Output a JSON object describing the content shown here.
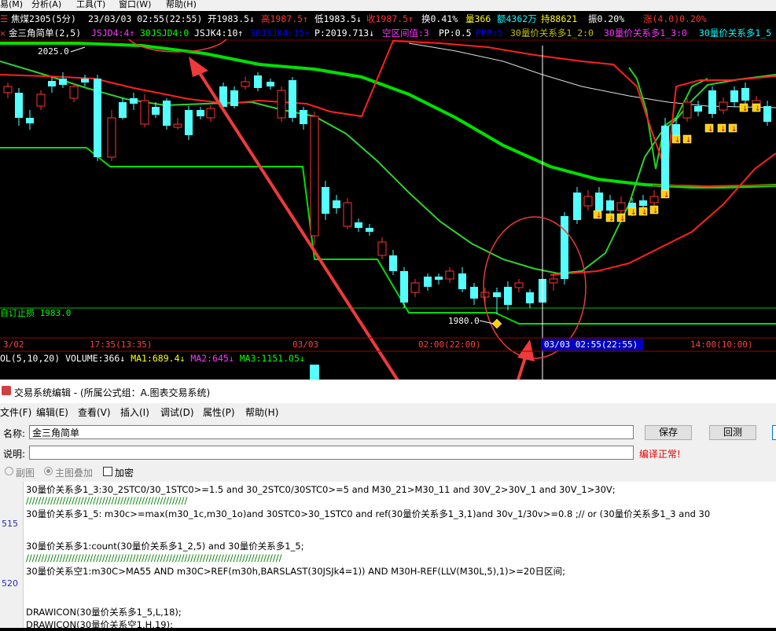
{
  "menubar": {
    "items": [
      "易(M)",
      "分析(A)",
      "工具(T)",
      "窗口(W)",
      "帮助(H)"
    ]
  },
  "infobar": {
    "symbol": "焦煤2305(5分)",
    "datetime": "23/03/03 02:55(22:55)",
    "open": "开1983.5↓",
    "high": "高1987.5↑",
    "low": "低1983.5↓",
    "close": "收1987.5↑",
    "turnover": "换0.41%",
    "volume": "量366",
    "amount": "额4362万",
    "hold": "持88621",
    "amplitude": "振0.20%",
    "change": "涨(4.0)0.20%"
  },
  "indicator_bar": {
    "name": "金三角简单(2,5)",
    "items": [
      {
        "text": "JSJD4:4↑",
        "color": "#ff33ff"
      },
      {
        "text": "30JSJD4:0",
        "color": "#00ff00"
      },
      {
        "text": "JSJK4:10↑",
        "color": "#ffffff"
      },
      {
        "text": "30JSJK4:15↑",
        "color": "#0000ff"
      },
      {
        "text": "P:2019.713↓",
        "color": "#ffffff"
      },
      {
        "text": "空区间值:3",
        "color": "#ff33ff"
      },
      {
        "text": "PP:0.5",
        "color": "#ffffff"
      },
      {
        "text": "PPP:5",
        "color": "#0000ff"
      },
      {
        "text": "30量价关系多1_2:0",
        "color": "#c0c000"
      },
      {
        "text": "30量价关系多1_3:0",
        "color": "#ff33ff"
      },
      {
        "text": "30量价关系多1_5",
        "color": "#00ffff"
      }
    ]
  },
  "chart": {
    "label_high": "2025.0",
    "label_low": "1980.0",
    "stop_label": "自订止损 1983.0",
    "time_axis": [
      "3/02",
      "17:35(13:35)",
      "03/03",
      "02:00(22:00)",
      "03/03 02:55(22:55)",
      "14:00(10:00)"
    ],
    "colors": {
      "up": "#ff3232",
      "down": "#54ffff",
      "green": "#00ff00",
      "red": "#ff2020",
      "white": "#ffffff",
      "arrow": "#ee3a3a"
    }
  },
  "volume_bar": {
    "label": "OL(5,10,20) VOLUME:366↓",
    "ma1": "MA1:689.4↓",
    "ma2": "MA2:645↓",
    "ma3": "MA3:1151.05↓"
  },
  "editor": {
    "title": "交易系统编辑 - (所属公式组：A.图表交易系统)",
    "menu": [
      "文件(F)",
      "编辑(E)",
      "查看(V)",
      "插入(I)",
      "调试(D)",
      "属性(P)",
      "帮助(H)"
    ],
    "name_label": "名称:",
    "name_value": "金三角简单",
    "desc_label": "说明:",
    "desc_value": "",
    "save_button": "保存",
    "revert_button": "回测",
    "status": "编译正常!",
    "radio_sub": "副图",
    "radio_main": "主图叠加",
    "checkbox_encrypt": "加密",
    "line_numbers": [
      "515",
      "520"
    ],
    "code_lines": [
      "30量价关系多1_3:30_2STC0/30_1STC0>=1.5 and 30_2STC0/30STC0>=5  and M30_21>M30_11 and 30V_2>30V_1 and 30V_1>30V;",
      "/////////////////////////////////////////////////////",
      "30量价关系多1_5: m30c>=max(m30_1c,m30_1o)and  30STC0>30_1STC0 and ref(30量价关系多1_3,1)and 30v_1/30v>=0.8 ;// or (30量价关系多1_3 and 30",
      "",
      "30量价关系多1:count(30量价关系多1_2,5) and 30量价关系多1_5;",
      "////////////////////////////////////////////////////////////////////////////////////",
      "30量价关系空1:m30C>MA55 AND m30C>REF(m30h,BARSLAST(30JSJk4=1)) AND M30H-REF(LLV(M30L,5),1)>=20日区间;",
      "",
      "",
      "DRAWICON(30量价关系多1_5,L,18);",
      "DRAWICON(30量价关系空1,H,19);"
    ]
  }
}
